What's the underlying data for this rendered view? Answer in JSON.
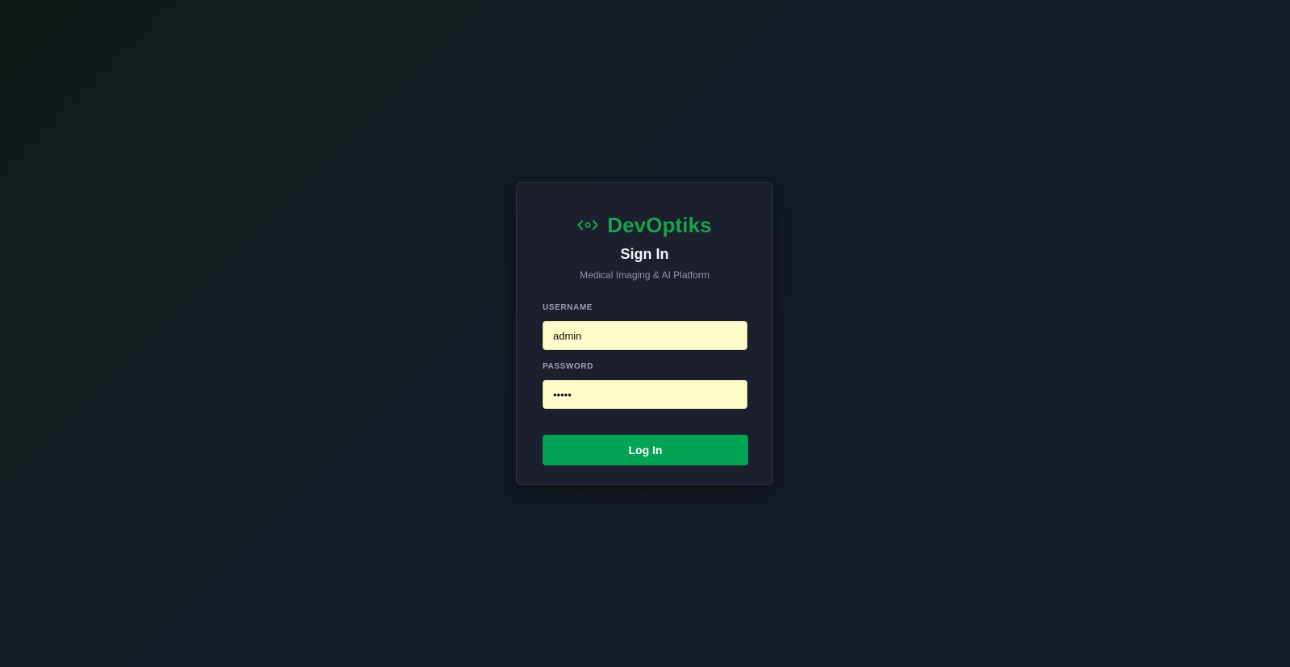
{
  "brand": {
    "name": "DevOptiks",
    "icon": "code-eye-icon",
    "color": "#16a34a"
  },
  "login": {
    "title": "Sign In",
    "subtitle": "Medical Imaging & AI Platform",
    "username_label": "USERNAME",
    "username_value": "admin",
    "password_label": "PASSWORD",
    "password_value": "admin",
    "submit_label": "Log In"
  },
  "colors": {
    "accent": "#02a454",
    "input_background": "#fefdc9",
    "card_background": "#1c1f2e"
  }
}
